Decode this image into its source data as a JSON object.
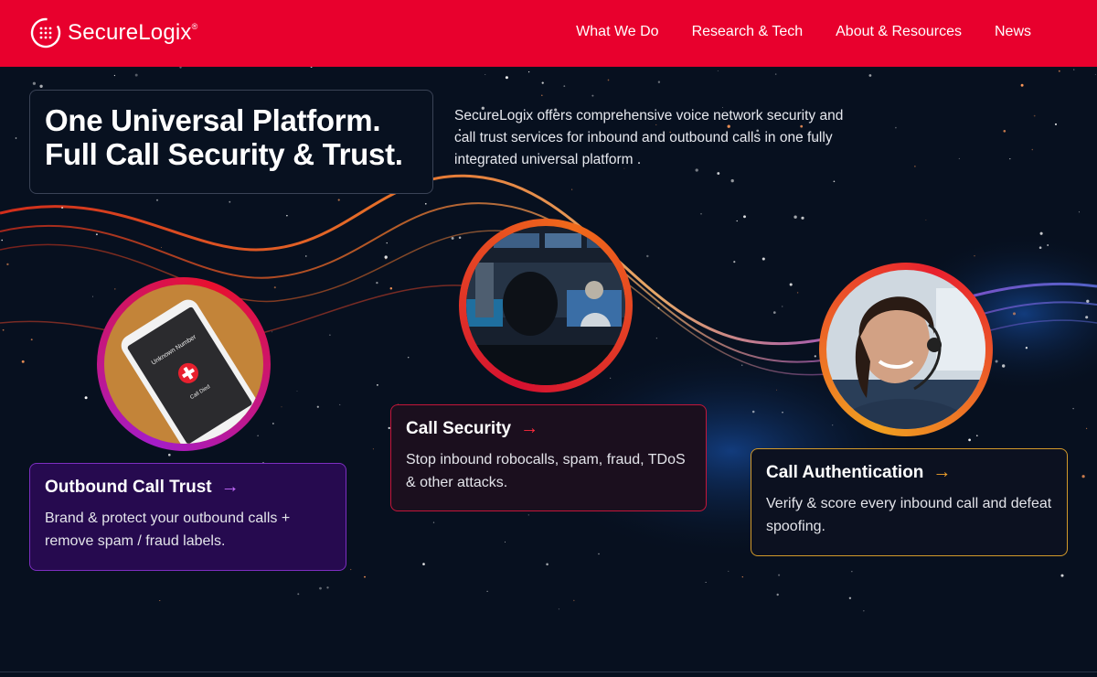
{
  "brand": {
    "name": "SecureLogix",
    "trademark": "®",
    "colors": {
      "primary": "#e8002d",
      "background": "#07101f"
    }
  },
  "nav": {
    "items": [
      "What We Do",
      "Research & Tech",
      "About & Resources",
      "News"
    ]
  },
  "hero": {
    "title_line1": "One Universal Platform.",
    "title_line2": "Full Call Security & Trust.",
    "description": "SecureLogix offers comprehensive voice network security and call trust services for inbound and outbound calls in one fully integrated universal platform ."
  },
  "phone_screen": {
    "caller": "Unknown Number",
    "status": "Call Died"
  },
  "cards": [
    {
      "title": "Outbound Call Trust",
      "arrow": "→",
      "text": "Brand & protect your outbound calls + remove spam / fraud labels.",
      "border_color": "#7c2ec0"
    },
    {
      "title": "Call Security",
      "arrow": "→",
      "text": "Stop inbound robocalls, spam, fraud, TDoS & other attacks.",
      "border_color": "#c4163a"
    },
    {
      "title": "Call Authentication",
      "arrow": "→",
      "text": "Verify & score every inbound call and defeat spoofing.",
      "border_color": "#d39a2a"
    }
  ],
  "icons": [
    "securelogix-logo-icon",
    "arrow-right-icon",
    "phone-image",
    "security-operator-image",
    "call-agent-image"
  ]
}
